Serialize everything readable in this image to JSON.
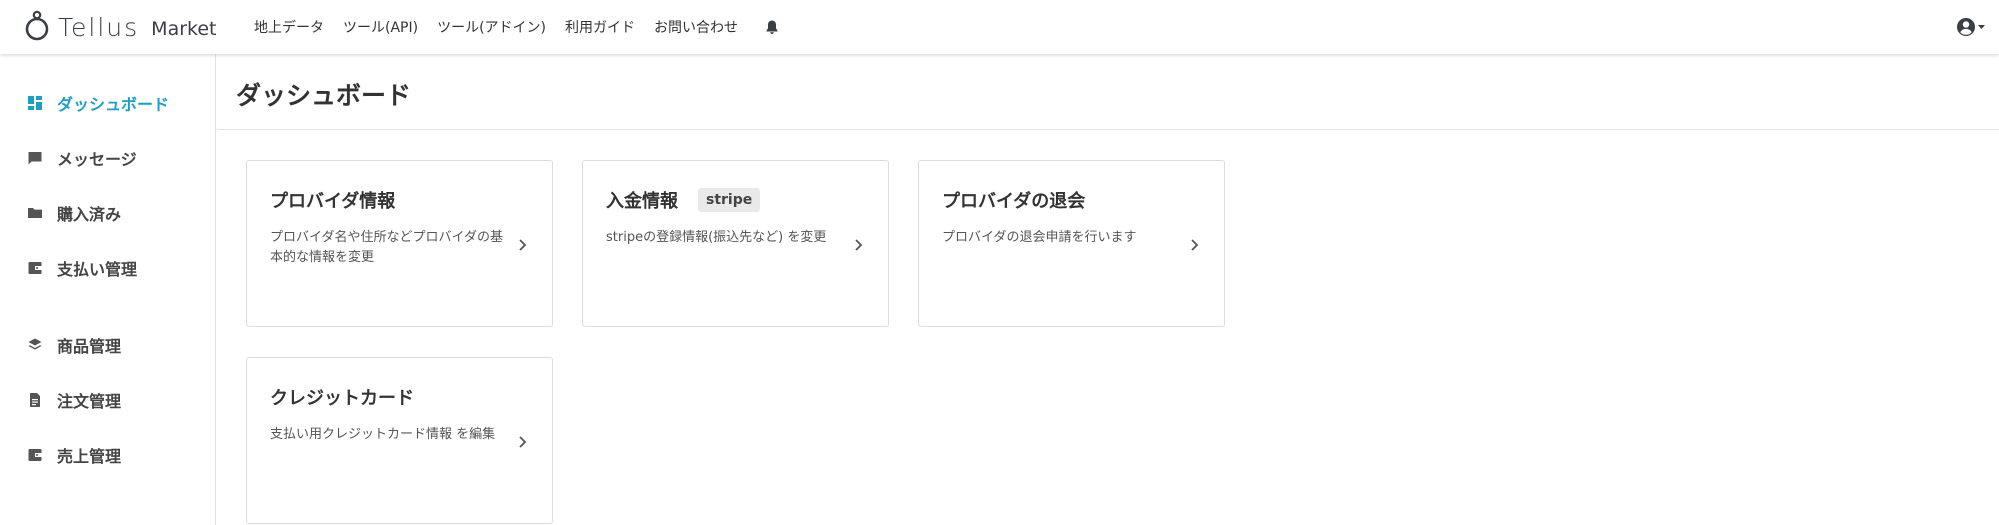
{
  "header": {
    "logo_word": "Tellus",
    "logo_sub": "Market",
    "nav": [
      "地上データ",
      "ツール(API)",
      "ツール(アドイン)",
      "利用ガイド",
      "お問い合わせ"
    ],
    "bell_icon": "bell-icon",
    "user_icon": "user-circle-icon"
  },
  "sidebar": {
    "items": [
      {
        "label": "ダッシュボード",
        "icon": "dashboard-icon",
        "active": true
      },
      {
        "label": "メッセージ",
        "icon": "message-icon",
        "active": false
      },
      {
        "label": "購入済み",
        "icon": "folder-icon",
        "active": false
      },
      {
        "label": "支払い管理",
        "icon": "wallet-icon",
        "active": false
      },
      {
        "label": "商品管理",
        "icon": "layers-icon",
        "active": false
      },
      {
        "label": "注文管理",
        "icon": "document-icon",
        "active": false
      },
      {
        "label": "売上管理",
        "icon": "wallet-icon",
        "active": false
      }
    ]
  },
  "main": {
    "title": "ダッシュボード",
    "cards": [
      {
        "title": "プロバイダ情報",
        "description": "プロバイダ名や住所などプロバイダの基本的な情報を変更"
      },
      {
        "title": "入金情報",
        "badge": "stripe",
        "description": "stripeの登録情報(振込先など) を変更"
      },
      {
        "title": "プロバイダの退会",
        "description": "プロバイダの退会申請を行います"
      },
      {
        "title": "クレジットカード",
        "description": "支払い用クレジットカード情報 を編集"
      }
    ]
  },
  "colors": {
    "accent": "#1aa0c7",
    "text": "#333333",
    "border": "#dcdcdc"
  }
}
